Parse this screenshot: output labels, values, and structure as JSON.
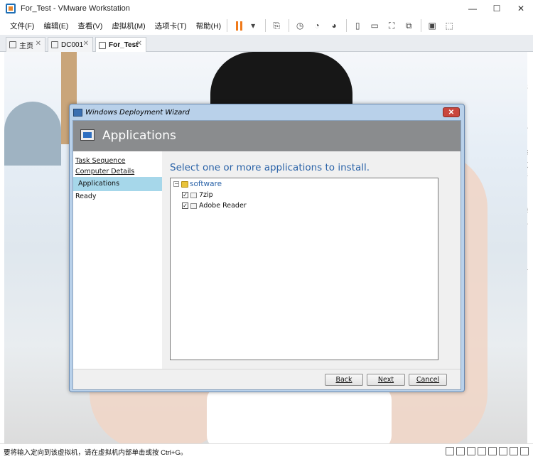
{
  "window": {
    "title": "For_Test - VMware Workstation"
  },
  "window_controls": {
    "minimize": "—",
    "maximize": "☐",
    "close": "✕"
  },
  "menu": [
    "文件(F)",
    "编辑(E)",
    "查看(V)",
    "虚拟机(M)",
    "选项卡(T)",
    "帮助(H)"
  ],
  "tabs": [
    {
      "label": "主页",
      "close": "✕"
    },
    {
      "label": "DC001",
      "close": "✕"
    },
    {
      "label": "For_Test",
      "close": "✕"
    }
  ],
  "wizard": {
    "window_title": "Windows Deployment Wizard",
    "header_title": "Applications",
    "nav": [
      "Task Sequence",
      "Computer Details",
      "Applications",
      "Ready"
    ],
    "prompt": "Select one or more applications to install.",
    "tree": {
      "root": "software",
      "items": [
        {
          "label": "7zip",
          "checked": true
        },
        {
          "label": "Adobe Reader",
          "checked": true
        }
      ]
    },
    "buttons": {
      "back": "Back",
      "next": "Next",
      "cancel": "Cancel"
    }
  },
  "status": {
    "text": "要将输入定向到该虚拟机，请在虚拟机内部单击或按 Ctrl+G。"
  },
  "right_edge_glyphs": [
    "s",
    "今",
    "缉",
    "加",
    "名",
    "5",
    "今",
    "舌"
  ],
  "colors": {
    "prompt": "#2b63a8",
    "header": "#8a8c8e",
    "nav_selected": "#a6d7ea",
    "pause": "#f07a1a"
  }
}
